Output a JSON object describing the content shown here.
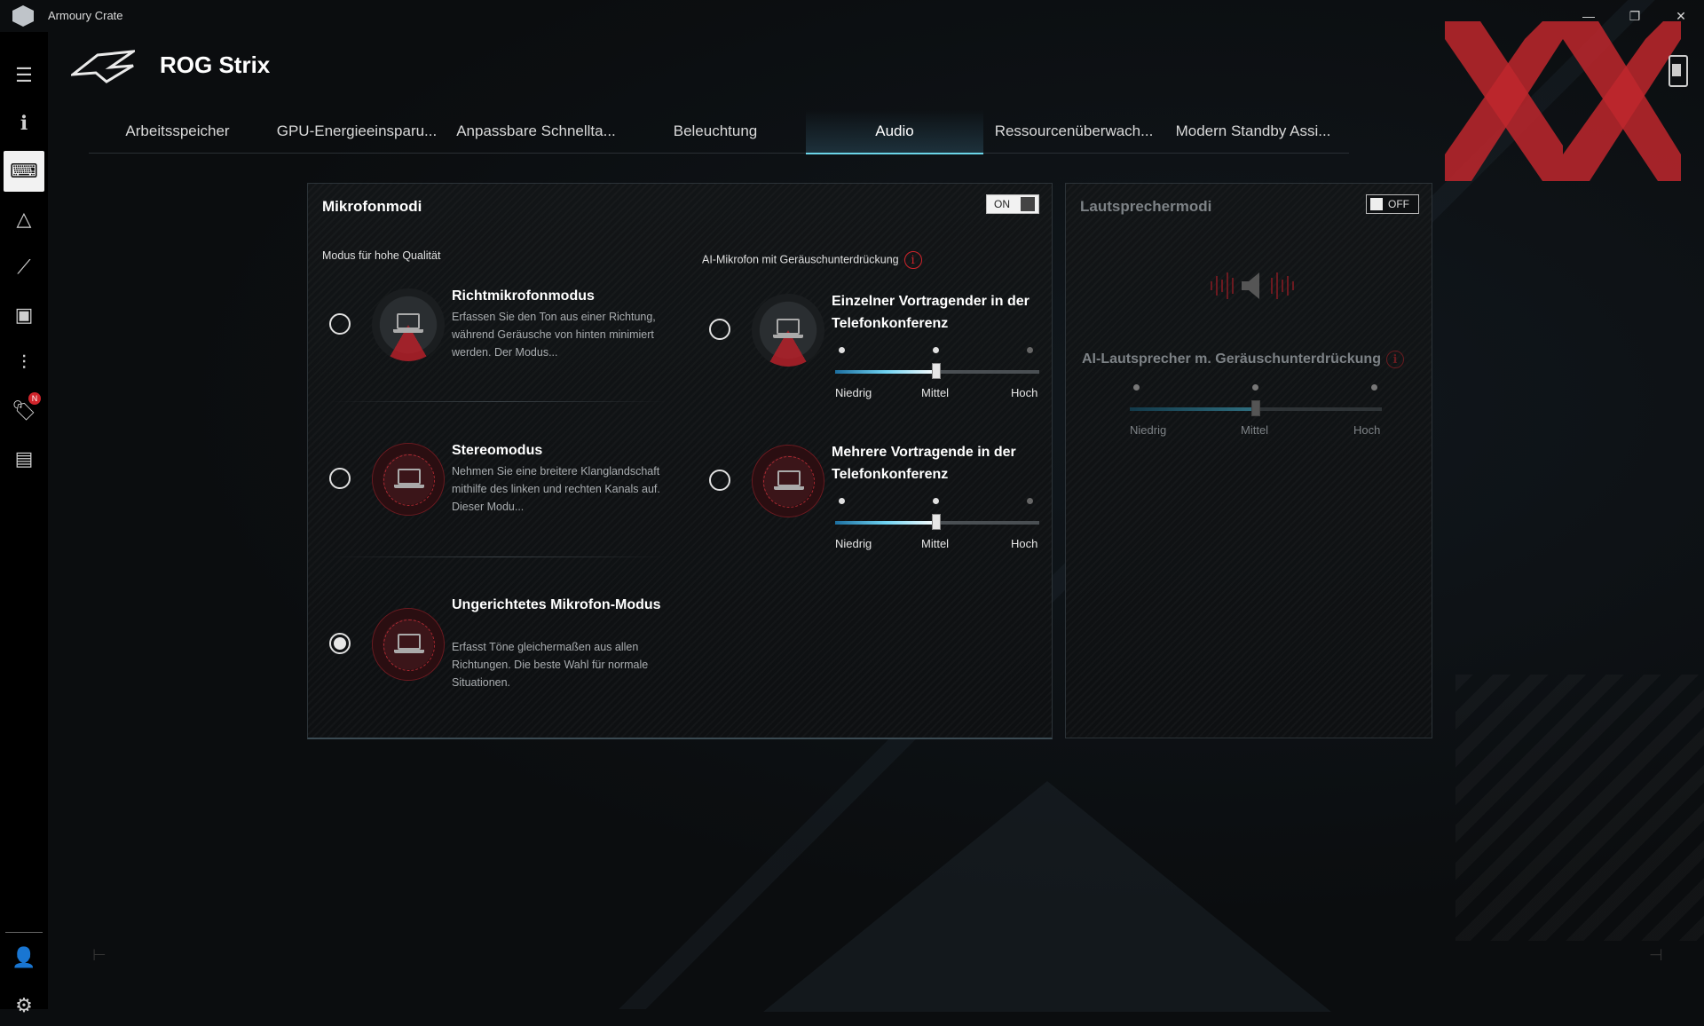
{
  "app": {
    "title": "Armoury Crate",
    "product": "ROG Strix"
  },
  "window_controls": [
    "—",
    "❐",
    "✕"
  ],
  "sidebar": {
    "items": [
      {
        "name": "menu-icon",
        "glyph": "☰"
      },
      {
        "name": "info-icon",
        "glyph": "ℹ"
      },
      {
        "name": "device-icon",
        "glyph": "⌨",
        "active": true
      },
      {
        "name": "aura-icon",
        "glyph": "△"
      },
      {
        "name": "rog-icon",
        "glyph": "⟋"
      },
      {
        "name": "game-library-icon",
        "glyph": "▣"
      },
      {
        "name": "equalizer-icon",
        "glyph": "⫶"
      },
      {
        "name": "deals-icon",
        "glyph": "🏷",
        "badge": "N"
      },
      {
        "name": "news-icon",
        "glyph": "▤"
      }
    ],
    "bottom": [
      {
        "name": "user-icon",
        "glyph": "👤"
      },
      {
        "name": "settings-icon",
        "glyph": "⚙"
      }
    ]
  },
  "tabs": [
    {
      "label": "Arbeitsspeicher",
      "active": false
    },
    {
      "label": "GPU-Energieeinsparu...",
      "active": false
    },
    {
      "label": "Anpassbare Schnellta...",
      "active": false
    },
    {
      "label": "Beleuchtung",
      "active": false
    },
    {
      "label": "Audio",
      "active": true
    },
    {
      "label": "Ressourcenüberwach...",
      "active": false
    },
    {
      "label": "Modern Standby Assi...",
      "active": false
    }
  ],
  "mic_panel": {
    "title": "Mikrofonmodi",
    "toggle": "ON",
    "quality_label": "Modus für hohe Qualität",
    "ai_label": "AI-Mikrofon mit Geräuschunterdrückung",
    "info_glyph": "i",
    "modes": [
      {
        "title": "Richtmikrofonmodus",
        "desc": "Erfassen Sie den Ton aus einer Richtung, während Geräusche von hinten minimiert werden. Der Modus...",
        "selected": false
      },
      {
        "title": "Stereomodus",
        "desc": "Nehmen Sie eine breitere Klanglandschaft mithilfe des linken und rechten Kanals auf. Dieser Modu...",
        "selected": false
      },
      {
        "title": "Ungerichtetes Mikrofon-Modus",
        "desc": "Erfasst Töne gleichermaßen aus allen Richtungen. Die beste Wahl für normale Situationen.",
        "selected": true
      }
    ],
    "ai_modes": [
      {
        "title": "Einzelner Vortragender in der Telefonkonferenz",
        "selected": false,
        "level": "Mittel"
      },
      {
        "title": "Mehrere Vortragende in der Telefonkonferenz",
        "selected": false,
        "level": "Mittel"
      }
    ],
    "levels": [
      "Niedrig",
      "Mittel",
      "Hoch"
    ]
  },
  "speaker_panel": {
    "title": "Lautsprechermodi",
    "toggle": "OFF",
    "ai_label": "AI-Lautsprecher m. Geräuschunterdrückung",
    "info_glyph": "i",
    "level": "Mittel",
    "levels": [
      "Niedrig",
      "Mittel",
      "Hoch"
    ]
  },
  "colors": {
    "accent_red": "#d0242b",
    "accent_cyan": "#6bd5e8",
    "watermark_red": "#c0272d"
  }
}
